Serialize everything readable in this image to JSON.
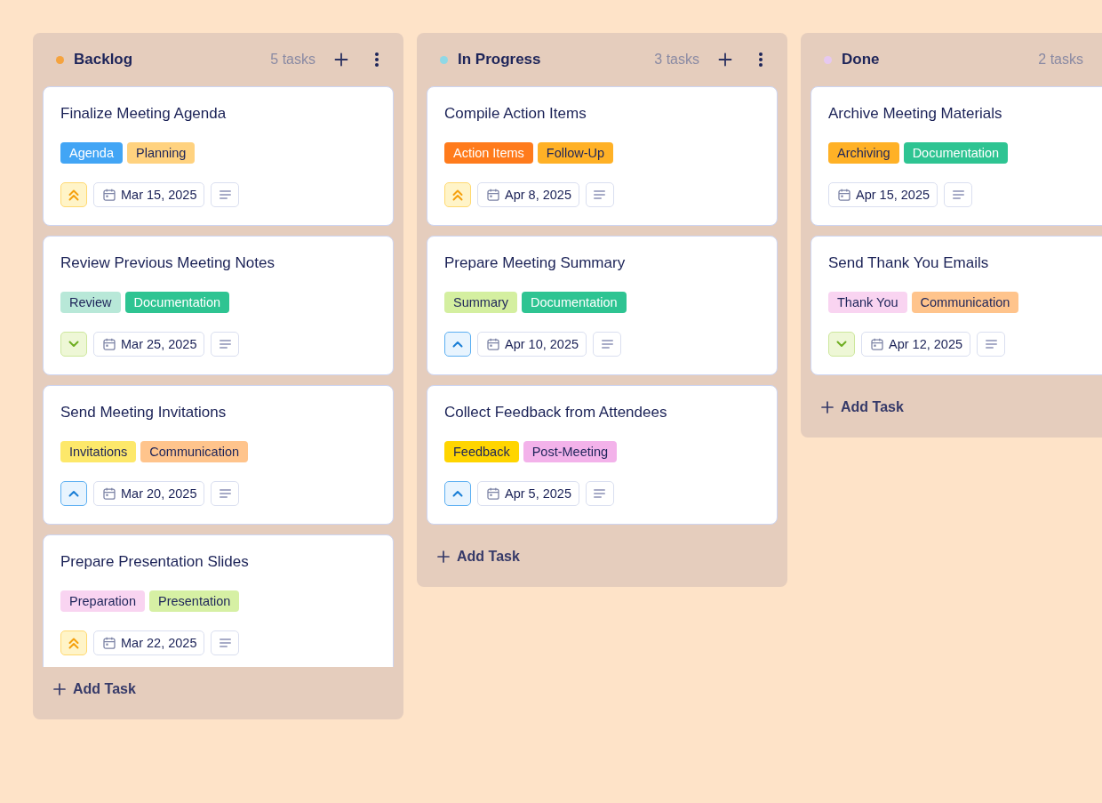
{
  "columns": [
    {
      "title": "Backlog",
      "color": "#f5a33e",
      "count": "5 tasks",
      "header_buttons": [
        {
          "kind": "add"
        },
        {
          "kind": "menu"
        }
      ],
      "cards": [
        {
          "title": "Finalize Meeting Agenda",
          "tags": [
            {
              "label": "Agenda",
              "color": "#42a5f5"
            },
            {
              "label": "Planning",
              "color": "#ffd27f"
            }
          ],
          "priority": {
            "kind": "highest"
          },
          "date": "Mar 15, 2025"
        },
        {
          "title": "Review Previous Meeting Notes",
          "tags": [
            {
              "label": "Review",
              "color": "#b8e8d8"
            },
            {
              "label": "Documentation",
              "color": "#2ec492"
            }
          ],
          "priority": {
            "kind": "low"
          },
          "date": "Mar 25, 2025"
        },
        {
          "title": "Send Meeting Invitations",
          "tags": [
            {
              "label": "Invitations",
              "color": "#fde86a"
            },
            {
              "label": "Communication",
              "color": "#ffc48c"
            }
          ],
          "priority": {
            "kind": "high"
          },
          "date": "Mar 20, 2025"
        },
        {
          "title": "Prepare Presentation Slides",
          "tags": [
            {
              "label": "Preparation",
              "color": "#f9d4f1"
            },
            {
              "label": "Presentation",
              "color": "#d6f0a4"
            }
          ],
          "priority": {
            "kind": "highest"
          },
          "date": "Mar 22, 2025"
        }
      ],
      "add_task": "Add Task"
    },
    {
      "title": "In Progress",
      "color": "#8fd8e6",
      "count": "3 tasks",
      "header_buttons": [
        {
          "kind": "add"
        },
        {
          "kind": "menu"
        }
      ],
      "cards": [
        {
          "title": "Compile Action Items",
          "tags": [
            {
              "label": "Action Items",
              "color": "#ff7b1c"
            },
            {
              "label": "Follow-Up",
              "color": "#ffb126"
            }
          ],
          "priority": {
            "kind": "highest"
          },
          "date": "Apr 8, 2025"
        },
        {
          "title": "Prepare Meeting Summary",
          "tags": [
            {
              "label": "Summary",
              "color": "#d4efa0"
            },
            {
              "label": "Documentation",
              "color": "#2ec492"
            }
          ],
          "priority": {
            "kind": "high"
          },
          "date": "Apr 10, 2025"
        },
        {
          "title": "Collect Feedback from Attendees",
          "tags": [
            {
              "label": "Feedback",
              "color": "#ffd500"
            },
            {
              "label": "Post-Meeting",
              "color": "#f3b2ea"
            }
          ],
          "priority": {
            "kind": "high"
          },
          "date": "Apr 5, 2025"
        }
      ],
      "add_task": "Add Task"
    },
    {
      "title": "Done",
      "color": "#e6c8f0",
      "count": "2 tasks",
      "cards": [
        {
          "title": "Archive Meeting Materials",
          "tags": [
            {
              "label": "Archiving",
              "color": "#ffb126"
            },
            {
              "label": "Documentation",
              "color": "#2ec492"
            }
          ],
          "date": "Apr 15, 2025"
        },
        {
          "title": "Send Thank You Emails",
          "tags": [
            {
              "label": "Thank You",
              "color": "#f9d4f1"
            },
            {
              "label": "Communication",
              "color": "#ffc48c"
            }
          ],
          "priority": {
            "kind": "low"
          },
          "date": "Apr 12, 2025"
        }
      ],
      "add_task": "Add Task"
    }
  ]
}
